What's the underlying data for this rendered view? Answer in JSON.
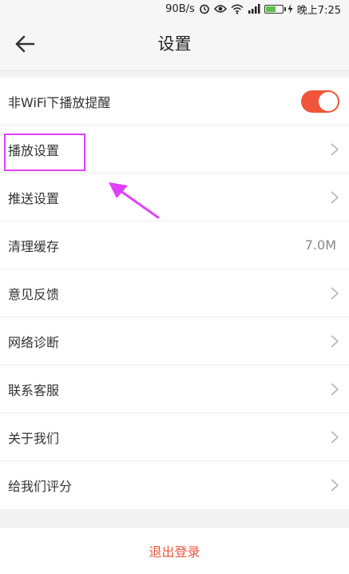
{
  "status_bar": {
    "speed": "90B/s",
    "time": "晚上7:25",
    "icons": [
      "alarm-icon",
      "eye-icon",
      "wifi-icon",
      "signal-icon",
      "battery-icon",
      "charging-icon"
    ],
    "battery_level_pct": 55
  },
  "header": {
    "title": "设置",
    "back_icon": "back-arrow-icon"
  },
  "settings": [
    {
      "label": "非WiFi下播放提醒",
      "toggle": true
    },
    {
      "label": "播放设置"
    },
    {
      "label": "推送设置"
    },
    {
      "label": "清理缓存",
      "value": "7.0M"
    },
    {
      "label": "意见反馈"
    },
    {
      "label": "网络诊断"
    },
    {
      "label": "联系客服"
    },
    {
      "label": "关于我们"
    },
    {
      "label": "给我们评分"
    }
  ],
  "logout": {
    "label": "退出登录"
  },
  "colors": {
    "accent": "#f0553a",
    "highlight": "#e040fb",
    "toggle_on": "#f0553a"
  }
}
